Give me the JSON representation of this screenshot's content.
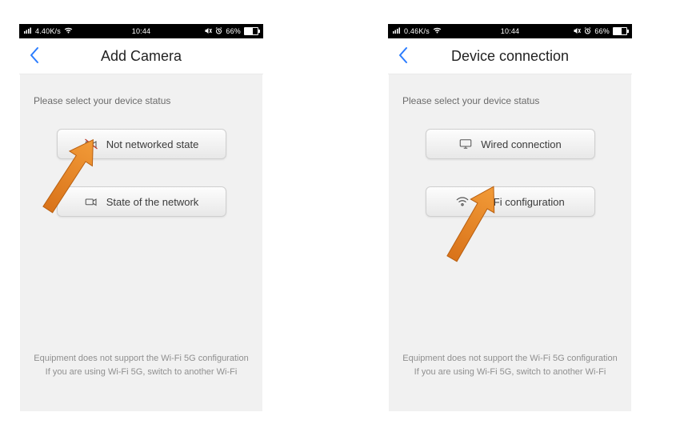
{
  "phones": [
    {
      "status": {
        "speed": "4.40K/s",
        "time": "10:44",
        "battery": "66%"
      },
      "nav_title": "Add Camera",
      "prompt": "Please select your device status",
      "options": [
        {
          "icon": "camera-offline-icon",
          "label": "Not networked state"
        },
        {
          "icon": "camera-online-icon",
          "label": "State of the network"
        }
      ],
      "footer_line1": "Equipment does not support the Wi-Fi 5G configuration",
      "footer_line2": "If you are using Wi-Fi 5G, switch to another Wi-Fi"
    },
    {
      "status": {
        "speed": "0.46K/s",
        "time": "10:44",
        "battery": "66%"
      },
      "nav_title": "Device connection",
      "prompt": "Please select your device status",
      "options": [
        {
          "icon": "monitor-wired-icon",
          "label": "Wired connection"
        },
        {
          "icon": "wifi-icon",
          "label": "Wi-Fi configuration"
        }
      ],
      "footer_line1": "Equipment does not support the Wi-Fi 5G configuration",
      "footer_line2": "If you are using Wi-Fi 5G, switch to another Wi-Fi"
    }
  ]
}
